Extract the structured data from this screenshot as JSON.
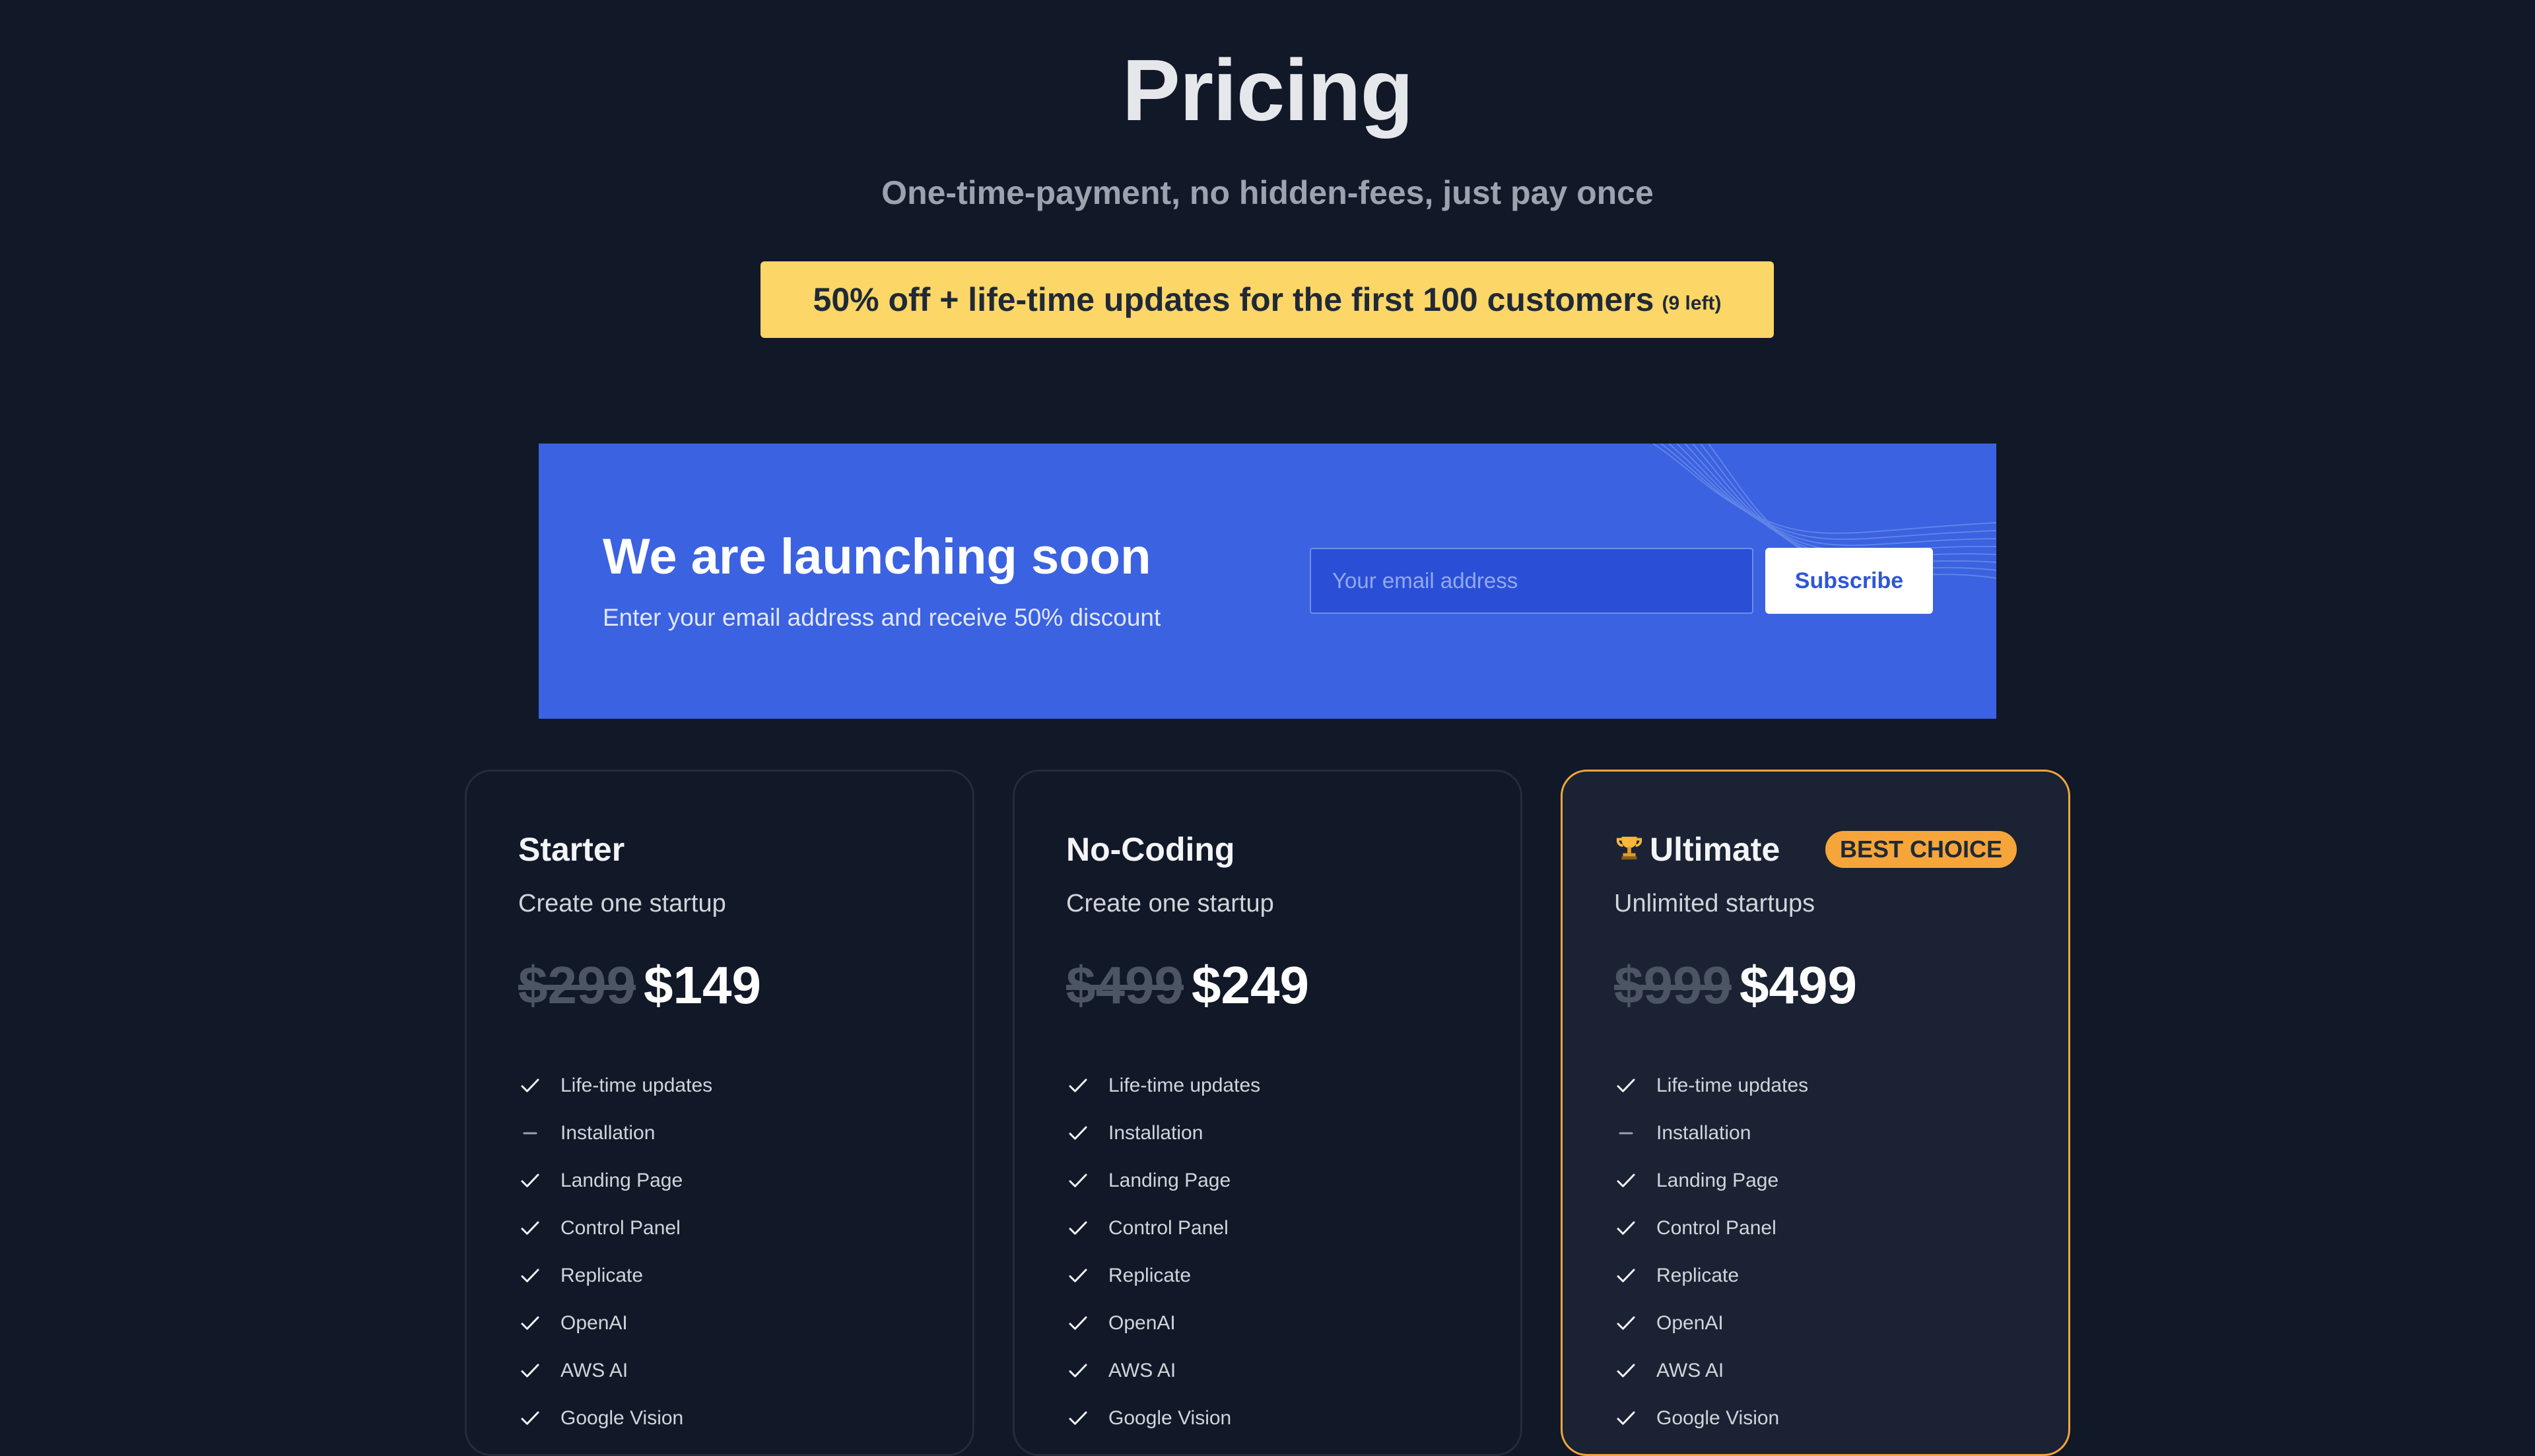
{
  "header": {
    "title": "Pricing",
    "subtitle": "One-time-payment, no hidden-fees, just pay once"
  },
  "promo": {
    "text": "50% off + life-time updates for the first 100 customers",
    "note": "(9 left)"
  },
  "launch": {
    "title": "We are launching soon",
    "subtitle": "Enter your email address and receive 50% discount",
    "email_placeholder": "Your email address",
    "subscribe_label": "Subscribe"
  },
  "plans": [
    {
      "name": "Starter",
      "description": "Create one startup",
      "old_price": "$299",
      "price": "$149",
      "features": [
        {
          "label": "Life-time updates",
          "included": true
        },
        {
          "label": "Installation",
          "included": false
        },
        {
          "label": "Landing Page",
          "included": true
        },
        {
          "label": "Control Panel",
          "included": true
        },
        {
          "label": "Replicate",
          "included": true
        },
        {
          "label": "OpenAI",
          "included": true
        },
        {
          "label": "AWS AI",
          "included": true
        },
        {
          "label": "Google Vision",
          "included": true
        }
      ]
    },
    {
      "name": "No-Coding",
      "description": "Create one startup",
      "old_price": "$499",
      "price": "$249",
      "features": [
        {
          "label": "Life-time updates",
          "included": true
        },
        {
          "label": "Installation",
          "included": true
        },
        {
          "label": "Landing Page",
          "included": true
        },
        {
          "label": "Control Panel",
          "included": true
        },
        {
          "label": "Replicate",
          "included": true
        },
        {
          "label": "OpenAI",
          "included": true
        },
        {
          "label": "AWS AI",
          "included": true
        },
        {
          "label": "Google Vision",
          "included": true
        }
      ]
    },
    {
      "name": "Ultimate",
      "icon": "trophy-icon",
      "badge": "BEST CHOICE",
      "description": "Unlimited startups",
      "old_price": "$999",
      "price": "$499",
      "features": [
        {
          "label": "Life-time updates",
          "included": true
        },
        {
          "label": "Installation",
          "included": false
        },
        {
          "label": "Landing Page",
          "included": true
        },
        {
          "label": "Control Panel",
          "included": true
        },
        {
          "label": "Replicate",
          "included": true
        },
        {
          "label": "OpenAI",
          "included": true
        },
        {
          "label": "AWS AI",
          "included": true
        },
        {
          "label": "Google Vision",
          "included": true
        }
      ]
    }
  ],
  "colors": {
    "background": "#111827",
    "promo": "#fcd667",
    "launch": "#3b62e0",
    "accent": "#f6a53a"
  }
}
